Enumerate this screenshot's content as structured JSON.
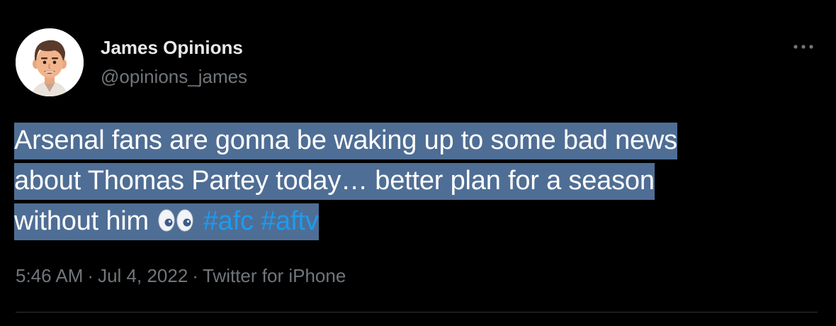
{
  "author": {
    "display_name": "James Opinions",
    "handle": "@opinions_james",
    "avatar_icon": "cartoon-man-avatar"
  },
  "tweet": {
    "line1": "Arsenal fans are gonna be waking up to some bad news",
    "line2": "about Thomas Partey today… better plan for a season",
    "line3_text": "without him",
    "emoji": "eyes-emoji",
    "hashtags": [
      "#afc",
      "#aftv"
    ],
    "selection_color": "#4f6e95",
    "hashtag_color": "#1d9bf0"
  },
  "meta": {
    "time": "5:46 AM",
    "separator": "·",
    "date": "Jul 4, 2022",
    "source": "Twitter for iPhone"
  },
  "menu": {
    "more_icon": "more-horizontal-icon"
  }
}
